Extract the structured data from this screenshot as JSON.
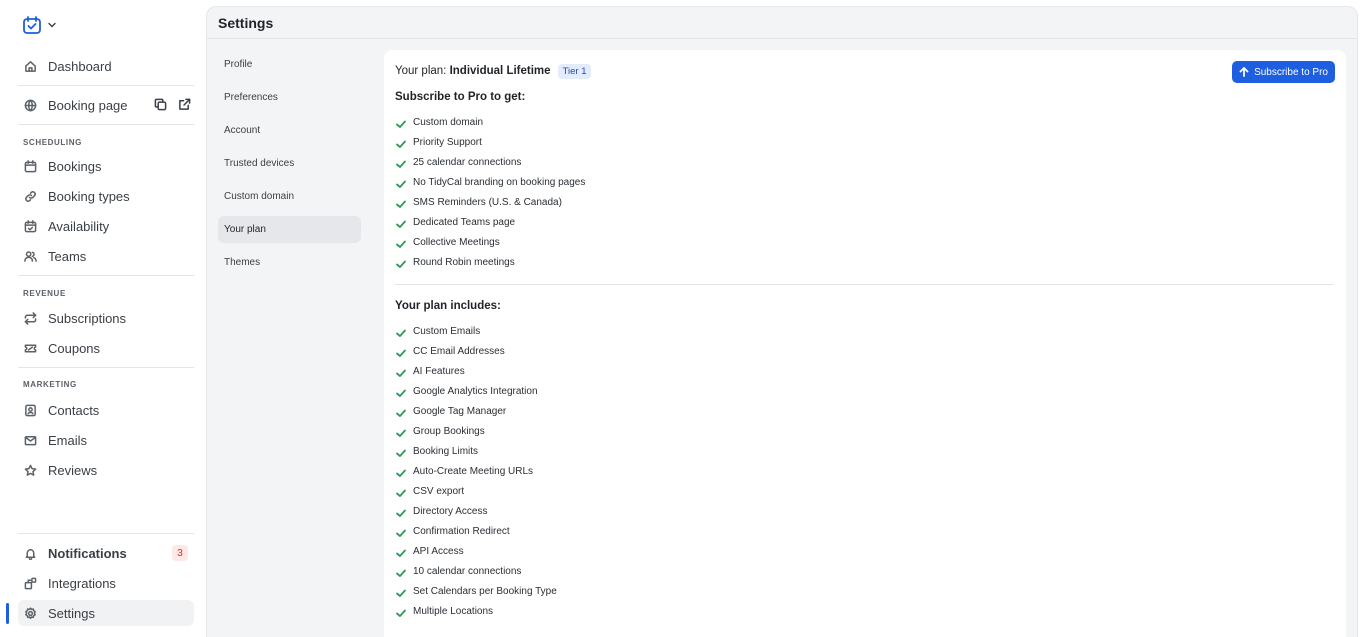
{
  "sidebar": {
    "dashboard": "Dashboard",
    "booking_page": "Booking page",
    "scheduling_label": "SCHEDULING",
    "bookings": "Bookings",
    "booking_types": "Booking types",
    "availability": "Availability",
    "teams": "Teams",
    "revenue_label": "REVENUE",
    "subscriptions": "Subscriptions",
    "coupons": "Coupons",
    "marketing_label": "MARKETING",
    "contacts": "Contacts",
    "emails": "Emails",
    "reviews": "Reviews",
    "notifications": "Notifications",
    "notifications_count": "3",
    "integrations": "Integrations",
    "settings": "Settings"
  },
  "header": {
    "title": "Settings"
  },
  "settings_nav": {
    "items": [
      "Profile",
      "Preferences",
      "Account",
      "Trusted devices",
      "Custom domain",
      "Your plan",
      "Themes"
    ],
    "active": "Your plan"
  },
  "plan": {
    "prefix": "Your plan: ",
    "name": "Individual Lifetime",
    "tier": "Tier 1",
    "subscribe_button": "Subscribe to Pro",
    "pro_title": "Subscribe to Pro to get:",
    "pro_features": [
      "Custom domain",
      "Priority Support",
      "25 calendar connections",
      "No TidyCal branding on booking pages",
      "SMS Reminders (U.S. & Canada)",
      "Dedicated Teams page",
      "Collective Meetings",
      "Round Robin meetings"
    ],
    "includes_title": "Your plan includes:",
    "included_features": [
      "Custom Emails",
      "CC Email Addresses",
      "AI Features",
      "Google Analytics Integration",
      "Google Tag Manager",
      "Group Bookings",
      "Booking Limits",
      "Auto-Create Meeting URLs",
      "CSV export",
      "Directory Access",
      "Confirmation Redirect",
      "API Access",
      "10 calendar connections",
      "Set Calendars per Booking Type",
      "Multiple Locations"
    ]
  },
  "colors": {
    "accent": "#1d5fe0",
    "check": "#2e9a57",
    "badge_red": "#d0312d"
  },
  "icons": {
    "logo": "calendar-check-icon",
    "dashboard": "home-icon",
    "booking_page": "globe-icon",
    "copy": "copy-icon",
    "open": "external-link-icon",
    "bookings": "calendar-icon",
    "booking_types": "link-icon",
    "availability": "calendar-clock-icon",
    "teams": "users-icon",
    "subscriptions": "repeat-icon",
    "coupons": "ticket-icon",
    "contacts": "contact-card-icon",
    "emails": "mail-icon",
    "reviews": "star-icon",
    "notifications": "bell-icon",
    "integrations": "puzzle-icon",
    "settings": "gear-icon",
    "check": "check-icon",
    "arrow_up": "arrow-up-icon"
  }
}
